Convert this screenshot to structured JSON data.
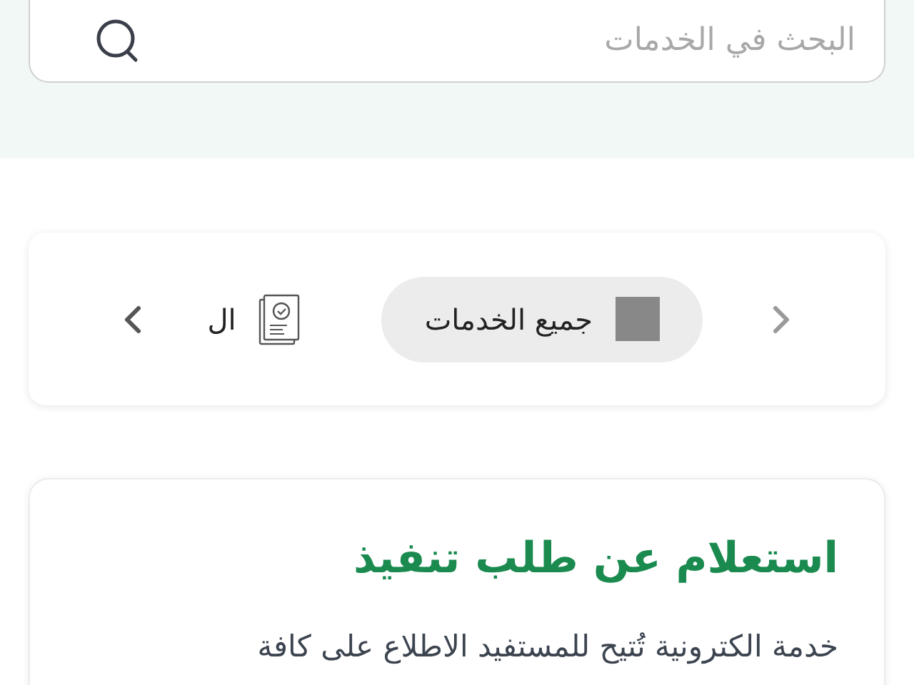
{
  "search": {
    "placeholder": "البحث في الخدمات"
  },
  "categories": {
    "prev_disabled": true,
    "next_disabled": false,
    "items": [
      {
        "label": "جميع الخدمات",
        "kind": "square",
        "selected": true
      },
      {
        "label": "ال",
        "kind": "document",
        "selected": false
      }
    ]
  },
  "service_card": {
    "title": "استعلام عن طلب تنفيذ",
    "description": "خدمة الكترونية تُتيح للمستفيد الاطلاع على كافة"
  }
}
